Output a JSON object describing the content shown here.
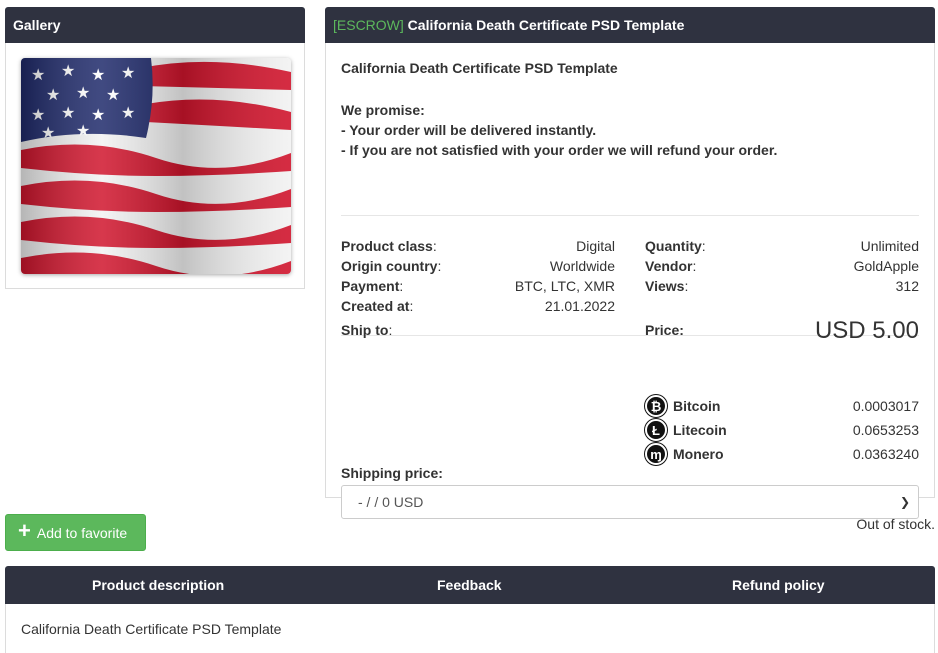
{
  "gallery": {
    "title": "Gallery"
  },
  "product": {
    "escrow_tag": "[ESCROW]",
    "title": "California Death Certificate PSD Template",
    "name": "California Death Certificate PSD Template",
    "promise_title": "We promise:",
    "promise_lines": [
      "- Your order will be delivered instantly.",
      "- If you are not satisfied with your order we will refund your order."
    ],
    "details_left": [
      {
        "key": "Product class",
        "value": "Digital"
      },
      {
        "key": "Origin country",
        "value": "Worldwide"
      },
      {
        "key": "Payment",
        "value": "BTC, LTC, XMR"
      },
      {
        "key": "Created at",
        "value": "21.01.2022"
      }
    ],
    "details_right": [
      {
        "key": "Quantity",
        "value": "Unlimited"
      },
      {
        "key": "Vendor",
        "value": "GoldApple"
      },
      {
        "key": "Views",
        "value": "312"
      }
    ],
    "ship_to_label": "Ship to",
    "price_label": "Price:",
    "price_value": "USD 5.00",
    "coins": [
      {
        "icon": "bitcoin-icon",
        "glyph": "₿",
        "name": "Bitcoin",
        "amount": "0.0003017"
      },
      {
        "icon": "litecoin-icon",
        "glyph": "Ł",
        "name": "Litecoin",
        "amount": "0.0653253"
      },
      {
        "icon": "monero-icon",
        "glyph": "ɱ",
        "name": "Monero",
        "amount": "0.0363240"
      }
    ],
    "shipping_price_label": "Shipping price:",
    "shipping_select_value": "- / / 0 USD"
  },
  "actions": {
    "add_favorite_label": "Add to favorite",
    "stock_status": "Out of stock."
  },
  "tabs": {
    "items": [
      "Product description",
      "Feedback",
      "Refund policy"
    ],
    "description_text": "California Death Certificate PSD Template"
  },
  "colors": {
    "header_bg": "#2f3240",
    "escrow_green": "#5cb85c",
    "link_blue": "#337ab7",
    "button_green": "#5cb85c"
  }
}
